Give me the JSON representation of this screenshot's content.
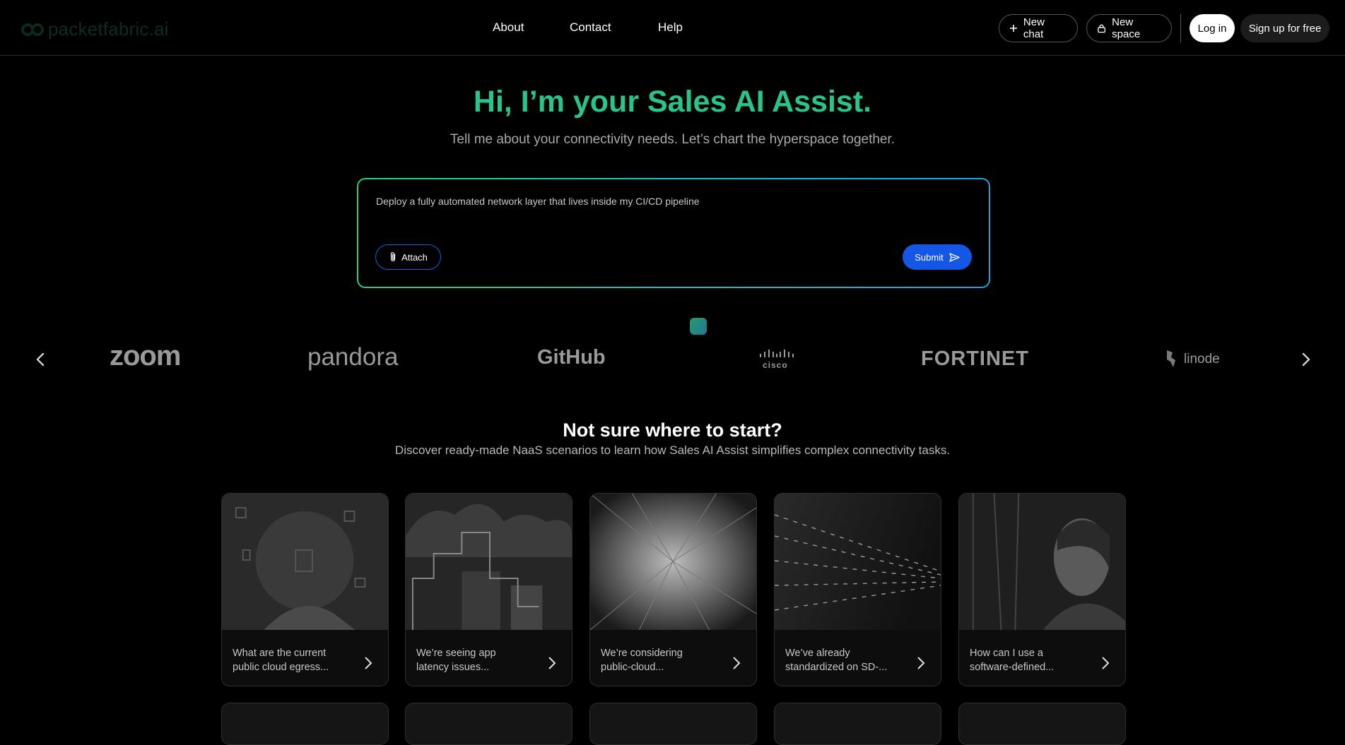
{
  "header": {
    "logo_text": "packetfabric.ai",
    "nav": [
      "About",
      "Contact",
      "Help"
    ],
    "new_chat_label": "New chat",
    "new_space_label": "New space",
    "login_label": "Log in",
    "signup_label": "Sign up for free"
  },
  "hero": {
    "title": "Hi, I’m your Sales AI Assist.",
    "subtitle": "Tell me about your connectivity needs. Let’s chart the hyperspace together."
  },
  "prompt": {
    "value": "Deploy a fully automated network layer that lives inside my CI/CD pipeline",
    "attach_label": "Attach",
    "submit_label": "Submit"
  },
  "brands": [
    "zoom",
    "pandora",
    "GitHub",
    "cisco",
    "FORTINET",
    "linode"
  ],
  "section": {
    "title": "Not sure where to start?",
    "subtitle": "Discover ready-made NaaS scenarios to learn how Sales AI Assist simplifies complex connectivity tasks."
  },
  "cards": [
    {
      "text": "What are the current public cloud egress..."
    },
    {
      "text": "We’re seeing app latency issues..."
    },
    {
      "text": "We’re considering public-cloud..."
    },
    {
      "text": "We’ve already standardized on SD-..."
    },
    {
      "text": "How can I use a software-defined..."
    }
  ],
  "colors": {
    "accent": "#28c48a",
    "submit": "#1457e6"
  }
}
